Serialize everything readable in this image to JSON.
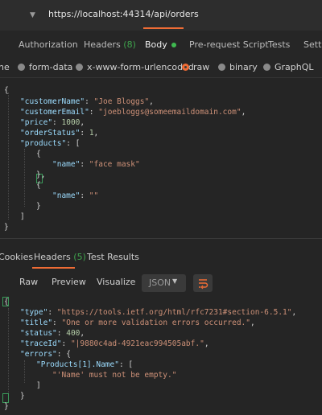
{
  "request": {
    "url": "https://localhost:44314/api/orders",
    "tabs": [
      {
        "label": "Authorization"
      },
      {
        "label": "Headers",
        "count": "(8)"
      },
      {
        "label": "Body"
      },
      {
        "label": "Pre-request Script"
      },
      {
        "label": "Tests"
      },
      {
        "label": "Settin"
      }
    ],
    "body_types": [
      {
        "label": "ne"
      },
      {
        "label": "form-data"
      },
      {
        "label": "x-www-form-urlencoded"
      },
      {
        "label": "raw"
      },
      {
        "label": "binary"
      },
      {
        "label": "GraphQL"
      }
    ],
    "body_lines": [
      "{",
      "\"customerName\": \"Joe Bloggs\",",
      "\"customerEmail\": \"joebloggs@someemaildomain.com\",",
      "\"price\": 1000,",
      "\"orderStatus\": 1,",
      "\"products\": [",
      "{",
      "\"name\": \"face mask\"",
      "},",
      "{",
      "\"name\": \"\"",
      "}",
      "]",
      "}"
    ]
  },
  "response": {
    "tabs": [
      {
        "label": "Cookies"
      },
      {
        "label": "Headers",
        "count": "(5)"
      },
      {
        "label": "Test Results"
      }
    ],
    "view_buttons": [
      "Raw",
      "Preview",
      "Visualize"
    ],
    "format": "JSON",
    "body_lines": [
      "{",
      "\"type\": \"https://tools.ietf.org/html/rfc7231#section-6.5.1\",",
      "\"title\": \"One or more validation errors occurred.\",",
      "\"status\": 400,",
      "\"traceId\": \"|9880c4ad-4921eac994505abf.\",",
      "\"errors\": {",
      "\"Products[1].Name\": [",
      "\"'Name' must not be empty.\"",
      "]",
      "}",
      "}"
    ]
  },
  "icons": [
    "chevron-down-icon",
    "radio-icon",
    "wrap-icon"
  ],
  "colors": {
    "accent": "#ef6c35",
    "count_green": "#3fa34d",
    "key": "#9cdcfe",
    "string": "#ce9178"
  }
}
